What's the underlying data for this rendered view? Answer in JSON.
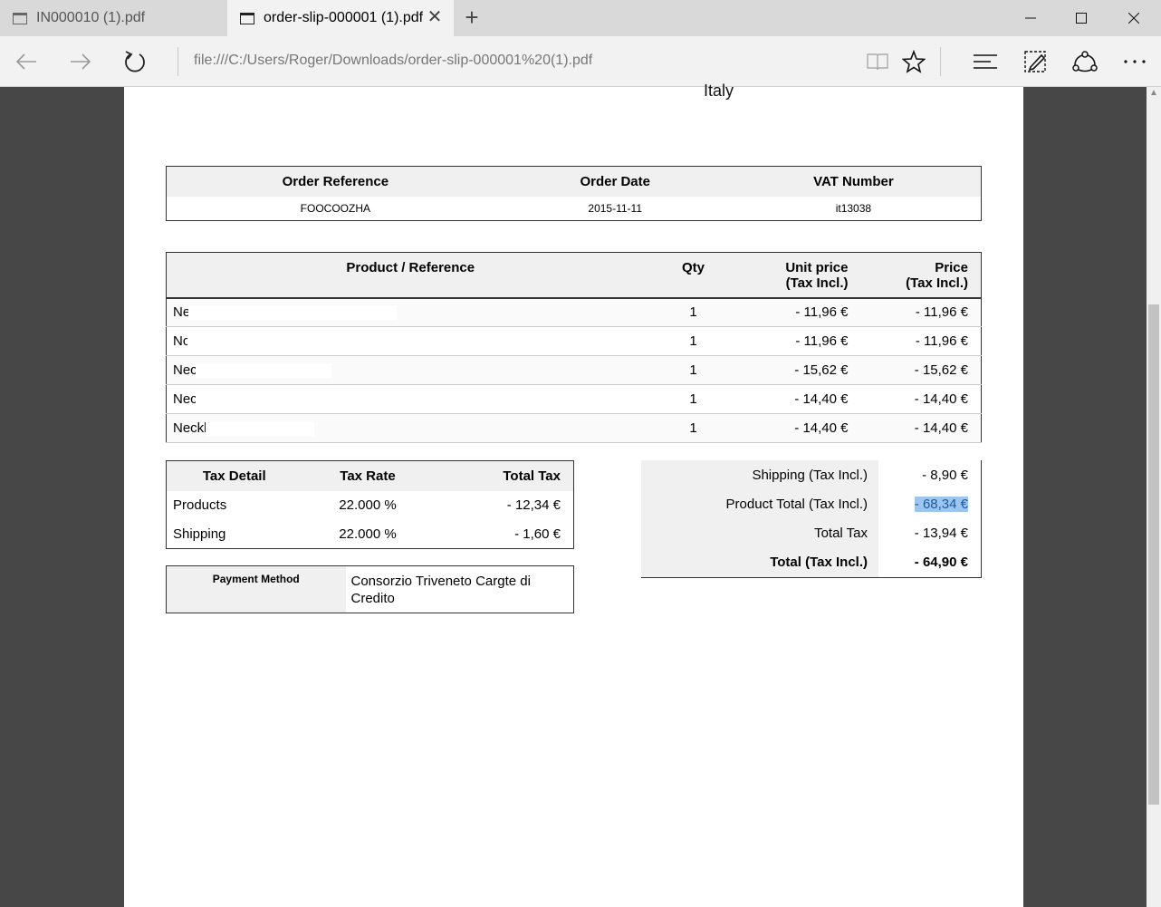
{
  "tabs": [
    {
      "title": "IN000010 (1).pdf"
    },
    {
      "title": "order-slip-000001 (1).pdf"
    }
  ],
  "window": {
    "minimize": "—",
    "maximize": "☐",
    "close": "✕"
  },
  "address": {
    "url": "file:///C:/Users/Roger/Downloads/order-slip-000001%20(1).pdf"
  },
  "document": {
    "country": "Italy",
    "order_table": {
      "headers": [
        "Order Reference",
        "Order Date",
        "VAT Number"
      ],
      "values": [
        "FOOCOOZHA",
        "2015-11-11",
        "it13038"
      ]
    },
    "products": {
      "headers": {
        "name": "Product / Reference",
        "qty": "Qty",
        "unit": "Unit price\n(Tax Incl.)",
        "price": "Price\n(Tax Incl.)"
      },
      "rows": [
        {
          "name": "Ne",
          "qty": "1",
          "unit": "- 11,96 €",
          "price": "- 11,96 €"
        },
        {
          "name": "Nc",
          "qty": "1",
          "unit": "- 11,96 €",
          "price": "- 11,96 €"
        },
        {
          "name": "Nec",
          "qty": "1",
          "unit": "- 15,62 €",
          "price": "- 15,62 €"
        },
        {
          "name": "Nec",
          "qty": "1",
          "unit": "- 14,40 €",
          "price": "- 14,40 €"
        },
        {
          "name": "Neckl",
          "qty": "1",
          "unit": "- 14,40 €",
          "price": "- 14,40 €"
        }
      ]
    },
    "tax": {
      "headers": [
        "Tax Detail",
        "Tax Rate",
        "Total Tax"
      ],
      "rows": [
        {
          "label": "Products",
          "rate": "22.000 %",
          "total": "- 12,34 €"
        },
        {
          "label": "Shipping",
          "rate": "22.000 %",
          "total": "- 1,60 €"
        }
      ]
    },
    "payment": {
      "label": "Payment Method",
      "value": "Consorzio Triveneto Cargte di Credito"
    },
    "totals": [
      {
        "label": "Shipping (Tax Incl.)",
        "value": "- 8,90 €"
      },
      {
        "label": "Product Total (Tax Incl.)",
        "value": "- 68,34 €"
      },
      {
        "label": "Total Tax",
        "value": "- 13,94 €"
      },
      {
        "label": "Total (Tax Incl.)",
        "value": "- 64,90 €"
      }
    ]
  }
}
